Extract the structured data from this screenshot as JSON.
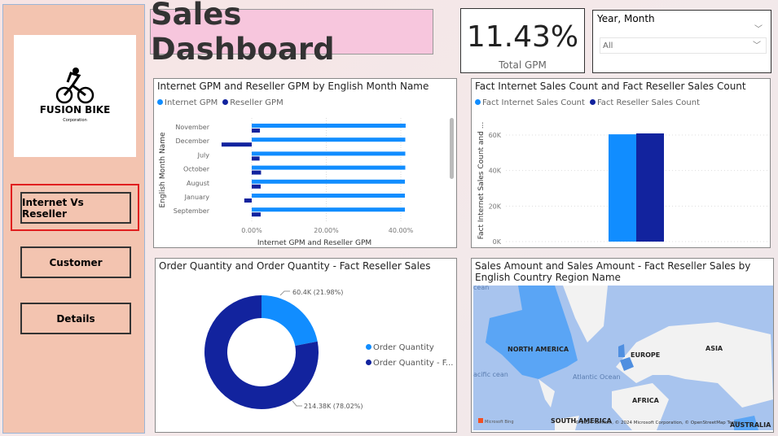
{
  "nav": {
    "logo_name": "FUSION BIKE",
    "logo_sub": "Corporation",
    "buttons": [
      "Internet Vs Reseller",
      "Customer",
      "Details"
    ],
    "selected": 0
  },
  "header": {
    "title": "Sales Dashboard"
  },
  "kpi": {
    "value": "11.43%",
    "label": "Total GPM"
  },
  "slicer": {
    "title": "Year, Month",
    "value": "All"
  },
  "colors": {
    "light": "#118dff",
    "dark": "#12239e",
    "panel_left": "#f3c4b0"
  },
  "chart_data": [
    {
      "type": "bar",
      "orientation": "horizontal",
      "title": "Internet GPM and Reseller GPM by English Month Name",
      "xlabel": "Internet GPM and Reseller GPM",
      "ylabel": "English Month Name",
      "categories": [
        "November",
        "December",
        "July",
        "October",
        "August",
        "January",
        "September"
      ],
      "series": [
        {
          "name": "Internet GPM",
          "values": [
            41.3,
            41.2,
            41.2,
            41.2,
            41.1,
            41.1,
            41.1
          ]
        },
        {
          "name": "Reseller GPM",
          "values": [
            2.2,
            -8.1,
            2.1,
            2.5,
            2.4,
            -2.0,
            2.4
          ]
        }
      ],
      "xticks": [
        "0.00%",
        "20.00%",
        "40.00%"
      ],
      "xlim": [
        -10,
        45
      ],
      "grid": true,
      "legend": "top-left"
    },
    {
      "type": "bar",
      "title": "Fact Internet Sales Count and Fact Reseller Sales Count",
      "ylabel": "Fact Internet Sales Count and ...",
      "series": [
        {
          "name": "Fact Internet Sales Count",
          "values": [
            60400
          ]
        },
        {
          "name": "Fact Reseller Sales Count",
          "values": [
            60900
          ]
        }
      ],
      "yticks": [
        "0K",
        "20K",
        "40K",
        "60K"
      ],
      "ylim": [
        0,
        70000
      ],
      "grid": true,
      "legend": "top-left"
    },
    {
      "type": "pie",
      "donut": true,
      "title": "Order Quantity and Order Quantity - Fact Reseller Sales",
      "series": [
        {
          "name": "Order Quantity",
          "value": 60400,
          "label": "60.4K (21.98%)"
        },
        {
          "name": "Order Quantity - F...",
          "value": 214380,
          "label": "214.38K (78.02%)"
        }
      ],
      "legend": "right"
    }
  ],
  "map": {
    "title": "Sales Amount and Sales Amount - Fact Reseller Sales by English Country Region Name",
    "labels": [
      "NORTH AMERICA",
      "EUROPE",
      "ASIA",
      "AFRICA",
      "SOUTH AMERICA",
      "AUSTRALIA",
      "Atlantic Ocean",
      "acific cean",
      "cean"
    ],
    "attribution": "© 2024 TomTom, © 2024 Microsoft Corporation, © OpenStreetMap Terms",
    "brand": "Microsoft Bing"
  }
}
